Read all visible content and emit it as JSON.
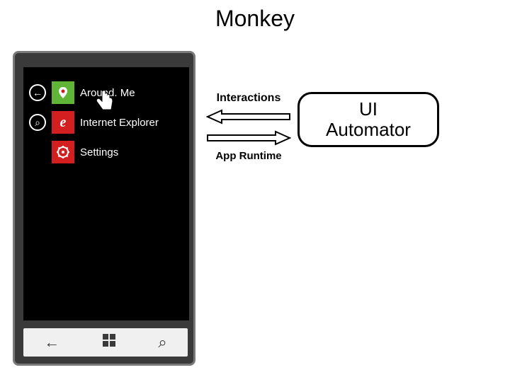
{
  "title": "Monkey",
  "phone": {
    "apps": [
      {
        "label": "Around. Me",
        "icon_name": "aroundme-icon",
        "pin_glyph": "←"
      },
      {
        "label": "Internet Explorer",
        "icon_name": "ie-icon",
        "pin_glyph": "⌕"
      },
      {
        "label": "Settings",
        "icon_name": "settings-icon",
        "pin_glyph": ""
      }
    ],
    "nav": {
      "back": "←",
      "home": "⊞",
      "search": "⌕"
    }
  },
  "arrows": {
    "top_label": "Interactions",
    "bottom_label": "App Runtime"
  },
  "automator": {
    "line1": "UI",
    "line2": "Automator"
  }
}
